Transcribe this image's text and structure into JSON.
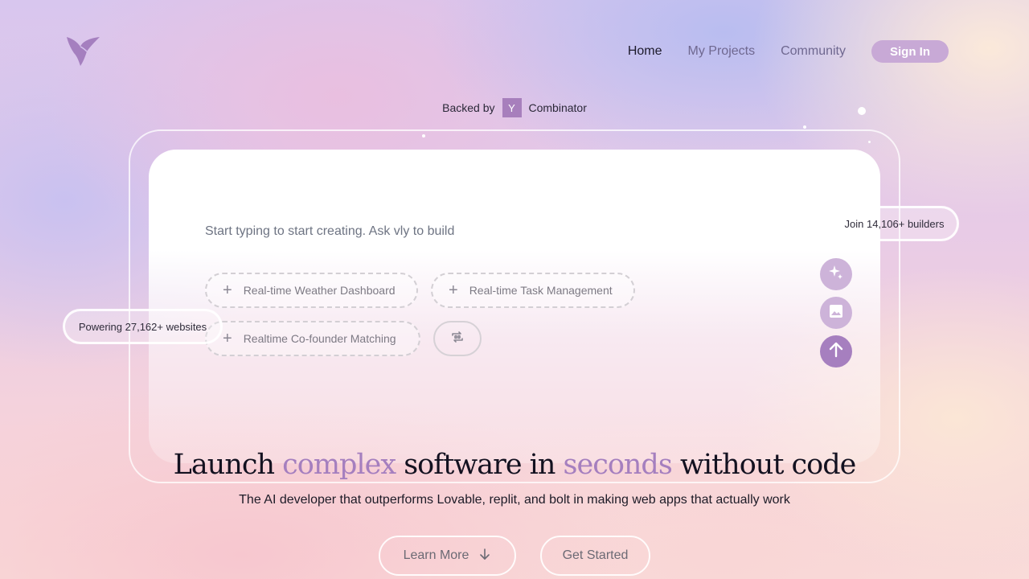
{
  "nav": {
    "home": "Home",
    "projects": "My Projects",
    "community": "Community",
    "signin": "Sign In"
  },
  "backed": {
    "prefix": "Backed by",
    "badge": "Y",
    "suffix": "Combinator"
  },
  "composer": {
    "prompt": "Start typing to start creating. Ask vly to build",
    "suggestions": [
      "Real-time Weather Dashboard",
      "Real-time Task Management",
      "Realtime Co-founder Matching"
    ]
  },
  "stats": {
    "builders": "Join 14,106+ builders",
    "websites": "Powering 27,162+ websites"
  },
  "hero": {
    "h1": "Launch",
    "h2": "complex",
    "h3": "software in",
    "h4": "seconds",
    "h5": "without code",
    "subtitle": "The AI developer that outperforms Lovable, replit, and bolt in making web apps that actually work"
  },
  "cta": {
    "learn_more": "Learn More",
    "get_started": "Get Started"
  },
  "colors": {
    "accent": "#a57fbf",
    "signin_bg": "#c8a9d6",
    "send_button": "#a67fbf"
  },
  "icons": [
    "bird-logo-icon",
    "plus-icon",
    "shuffle-icon",
    "sparkle-icon",
    "image-icon",
    "arrow-up-icon",
    "arrow-down-icon"
  ]
}
